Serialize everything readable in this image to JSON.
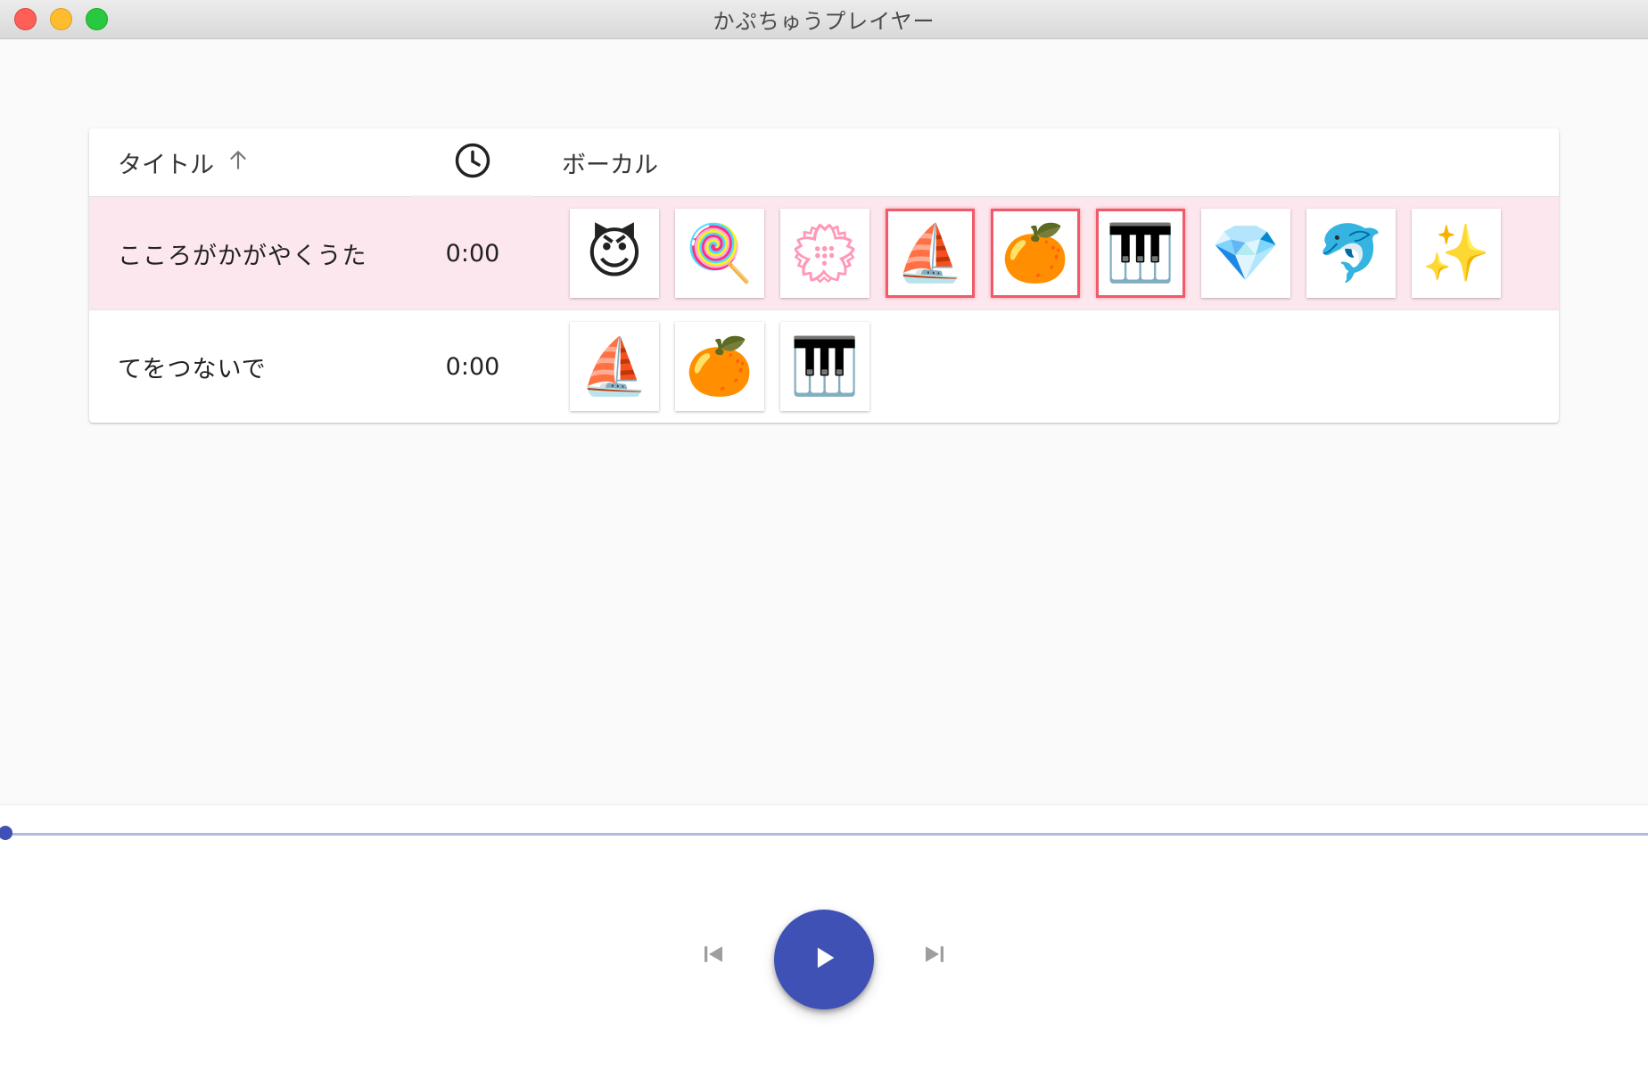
{
  "window": {
    "title": "かぷちゅうプレイヤー"
  },
  "table": {
    "headers": {
      "title": "タイトル",
      "sort_indicator": "arrow-up-icon",
      "time_icon": "clock-icon",
      "vocal": "ボーカル"
    },
    "rows": [
      {
        "title": "こころがかがやくうた",
        "time": "0:00",
        "selected": true,
        "vocals": [
          {
            "emoji": "😈",
            "name": "smiling-devil",
            "active": false
          },
          {
            "emoji": "🍭",
            "name": "lollipop",
            "active": false
          },
          {
            "emoji": "💮",
            "name": "white-flower-stamp",
            "active": false
          },
          {
            "emoji": "⛵",
            "name": "sailboat",
            "active": true
          },
          {
            "emoji": "🍊",
            "name": "tangerine",
            "active": true
          },
          {
            "emoji": "🎹",
            "name": "piano-keyboard",
            "active": true
          },
          {
            "emoji": "💎",
            "name": "gem",
            "active": false
          },
          {
            "emoji": "🐬",
            "name": "dolphin",
            "active": false
          },
          {
            "emoji": "✨",
            "name": "sparkles",
            "active": false
          }
        ]
      },
      {
        "title": "てをつないで",
        "time": "0:00",
        "selected": false,
        "vocals": [
          {
            "emoji": "⛵",
            "name": "sailboat",
            "active": false
          },
          {
            "emoji": "🍊",
            "name": "tangerine",
            "active": false
          },
          {
            "emoji": "🎹",
            "name": "piano-keyboard",
            "active": false
          }
        ]
      }
    ]
  },
  "player": {
    "progress": 0,
    "controls": [
      "skip-previous-icon",
      "play-icon",
      "skip-next-icon"
    ]
  },
  "colors": {
    "accent": "#3f51b5",
    "selected_row": "#fde7ee",
    "active_chip_border": "#f05a69"
  }
}
